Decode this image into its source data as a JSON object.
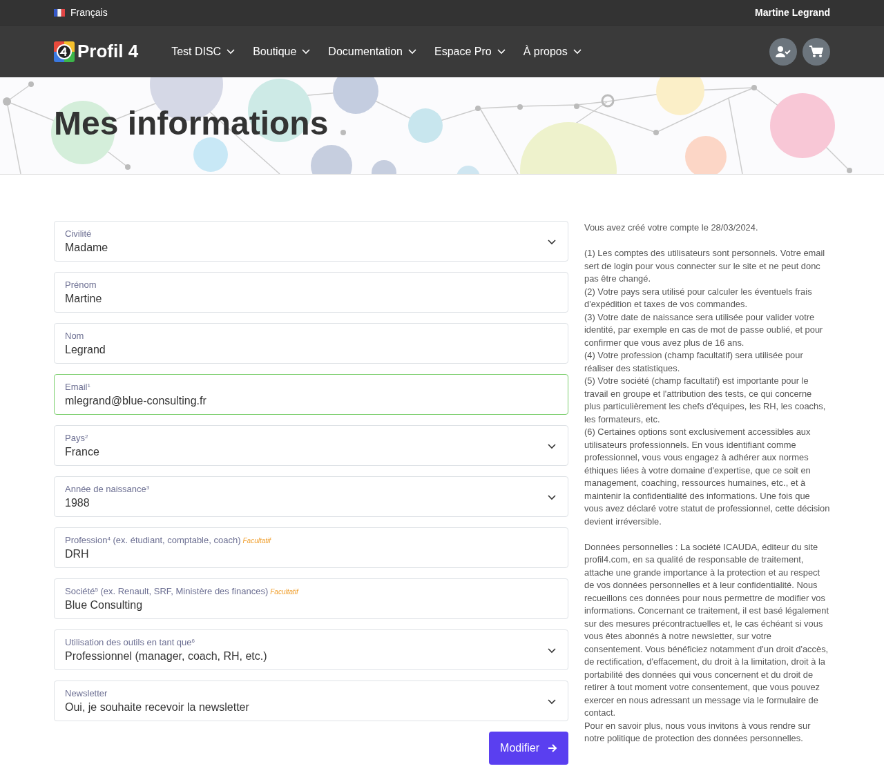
{
  "topbar": {
    "language": "Français",
    "user": "Martine Legrand"
  },
  "navbar": {
    "brand": "Profil 4",
    "menu": [
      {
        "label": "Test DISC"
      },
      {
        "label": "Boutique"
      },
      {
        "label": "Documentation"
      },
      {
        "label": "Espace Pro"
      },
      {
        "label": "À propos"
      }
    ]
  },
  "hero": {
    "title": "Mes informations"
  },
  "fields": [
    {
      "kind": "select",
      "label": "Civilité",
      "value": "Madame",
      "focused": false
    },
    {
      "kind": "text",
      "label": "Prénom",
      "value": "Martine",
      "focused": false
    },
    {
      "kind": "text",
      "label": "Nom",
      "value": "Legrand",
      "focused": false
    },
    {
      "kind": "text",
      "label": "Email$^{1}$",
      "value": "mlegrand@blue-consulting.fr",
      "focused": true
    },
    {
      "kind": "select",
      "label": "Pays$^{2}$",
      "value": "France",
      "focused": false
    },
    {
      "kind": "select",
      "label": "Année de naissance$^{3}$",
      "value": "1988",
      "focused": false
    },
    {
      "kind": "text",
      "label": "Profession$^{4}$ (ex. étudiant, comptable, coach)",
      "optional": "Facultatif",
      "value": "DRH",
      "focused": false
    },
    {
      "kind": "text",
      "label": "Société$^{5}$ (ex. Renault, SRF, Ministère des finances)",
      "optional": "Facultatif",
      "value": "Blue Consulting",
      "focused": false
    },
    {
      "kind": "select",
      "label": "Utilisation des outils en tant que$^{6}$",
      "value": "Professionnel (manager, coach, RH, etc.)",
      "focused": false
    },
    {
      "kind": "select",
      "label": "Newsletter",
      "value": "Oui, je souhaite recevoir la newsletter",
      "focused": false
    }
  ],
  "submit": "Modifier",
  "notes": [
    {
      "lines": [
        "Vous avez créé votre compte le 28/03/2024."
      ]
    },
    {
      "lines": [
        "(1) Les comptes des utilisateurs sont personnels. Votre email sert de login pour vous connecter sur le site et ne peut donc pas être changé.",
        "(2) Votre pays sera utilisé pour calculer les éventuels frais d'expédition et taxes de vos commandes.",
        "(3) Votre date de naissance sera utilisée pour valider votre identité, par exemple en cas de mot de passe oublié, et pour confirmer que vous avez plus de 16 ans.",
        "(4) Votre profession (champ facultatif) sera utilisée pour réaliser des statistiques.",
        "(5) Votre société (champ facultatif) est importante pour le travail en groupe et l'attribution des tests, ce qui concerne plus particulièrement les chefs d'équipes, les RH, les coachs, les formateurs, etc.",
        "(6) Certaines options sont exclusivement accessibles aux utilisateurs professionnels. En vous identifiant comme professionnel, vous vous engagez à adhérer aux normes éthiques liées à votre domaine d'expertise, que ce soit en management, coaching, ressources humaines, etc., et à maintenir la confidentialité des informations. Une fois que vous avez déclaré votre statut de professionnel, cette décision devient irréversible."
      ]
    },
    {
      "lines": [
        "Données personnelles : La société ICAUDA, éditeur du site profil4.com, en sa qualité de responsable de traitement, attache une grande importance à la protection et au respect de vos données personnelles et à leur confidentialité. Nous recueillons ces données pour nous permettre de modifier vos informations. Concernant ce traitement, il est basé légalement sur des mesures précontractuelles et, le cas échéant si vous vous êtes abonnés à notre newsletter, sur votre consentement. Vous bénéficiez notamment d'un droit d'accès, de rectification, d'effacement, du droit à la limitation, droit à la portabilité des données qui vous concernent et du droit de retirer à tout moment votre consentement, que vous pouvez exercer en nous adressant un message via le formulaire de contact.",
        "Pour en savoir plus, nous vous invitons à vous rendre sur notre politique de protection des données personnelles."
      ]
    }
  ]
}
